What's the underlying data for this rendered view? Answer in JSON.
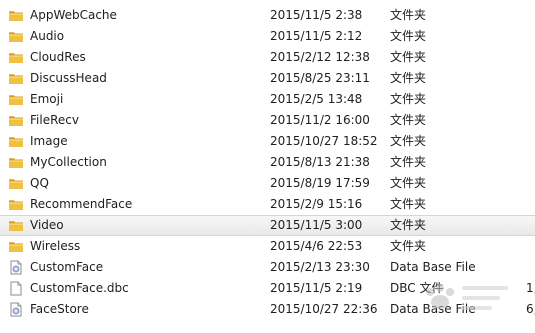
{
  "files": [
    {
      "name": "AppWebCache",
      "date": "2015/11/5 2:38",
      "type": "文件夹",
      "size": "",
      "icon": "folder-icon"
    },
    {
      "name": "Audio",
      "date": "2015/11/5 2:12",
      "type": "文件夹",
      "size": "",
      "icon": "folder-icon"
    },
    {
      "name": "CloudRes",
      "date": "2015/2/12 12:38",
      "type": "文件夹",
      "size": "",
      "icon": "folder-icon"
    },
    {
      "name": "DiscussHead",
      "date": "2015/8/25 23:11",
      "type": "文件夹",
      "size": "",
      "icon": "folder-icon"
    },
    {
      "name": "Emoji",
      "date": "2015/2/5 13:48",
      "type": "文件夹",
      "size": "",
      "icon": "folder-icon"
    },
    {
      "name": "FileRecv",
      "date": "2015/11/2 16:00",
      "type": "文件夹",
      "size": "",
      "icon": "folder-icon"
    },
    {
      "name": "Image",
      "date": "2015/10/27 18:52",
      "type": "文件夹",
      "size": "",
      "icon": "folder-icon"
    },
    {
      "name": "MyCollection",
      "date": "2015/8/13 21:38",
      "type": "文件夹",
      "size": "",
      "icon": "folder-icon"
    },
    {
      "name": "QQ",
      "date": "2015/8/19 17:59",
      "type": "文件夹",
      "size": "",
      "icon": "folder-icon"
    },
    {
      "name": "RecommendFace",
      "date": "2015/2/9 15:16",
      "type": "文件夹",
      "size": "",
      "icon": "folder-icon"
    },
    {
      "name": "Video",
      "date": "2015/11/5 3:00",
      "type": "文件夹",
      "size": "",
      "icon": "folder-icon",
      "selected": true
    },
    {
      "name": "Wireless",
      "date": "2015/4/6 22:53",
      "type": "文件夹",
      "size": "",
      "icon": "folder-icon"
    },
    {
      "name": "CustomFace",
      "date": "2015/2/13 23:30",
      "type": "Data Base File",
      "size": "",
      "icon": "database-file-icon"
    },
    {
      "name": "CustomFace.dbc",
      "date": "2015/11/5 2:19",
      "type": "DBC 文件",
      "size": "1,",
      "icon": "blank-file-icon"
    },
    {
      "name": "FaceStore",
      "date": "2015/10/27 22:36",
      "type": "Data Base File",
      "size": "6,",
      "icon": "database-file-icon"
    }
  ],
  "colors": {
    "folder": "#f0c040",
    "folder_dark": "#d69e22",
    "selection": "#ececec",
    "text": "#1e1e1e"
  },
  "watermark_icon": "baidu-jingyan-watermark-icon"
}
